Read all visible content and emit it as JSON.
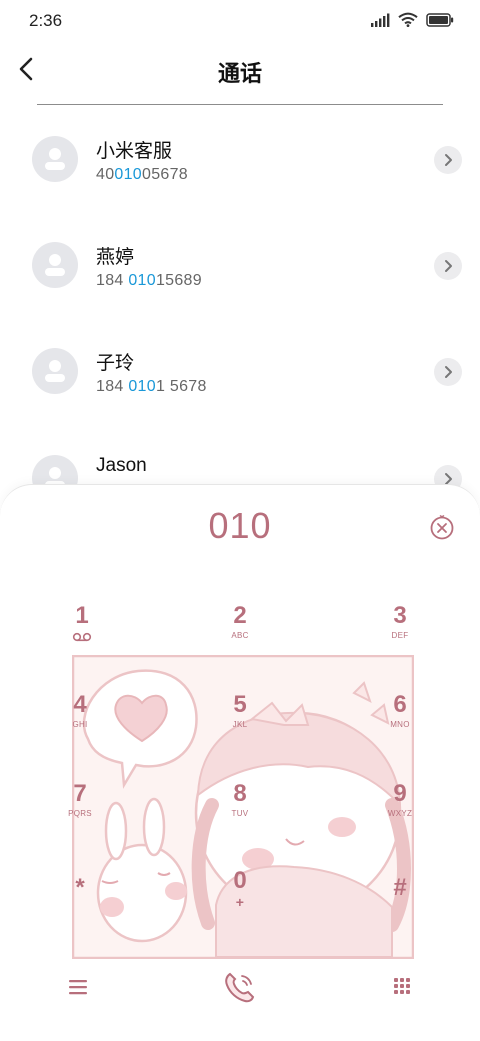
{
  "status": {
    "time": "2:36"
  },
  "header": {
    "title": "通话"
  },
  "contacts": [
    {
      "name": "小米客服",
      "num_pre": "40",
      "num_hl": "010",
      "num_post": "05678"
    },
    {
      "name": "燕婷",
      "num_pre": "184 ",
      "num_hl": "010",
      "num_post": "15689"
    },
    {
      "name": "子玲",
      "num_pre": "184 ",
      "num_hl": "010",
      "num_post": "1 5678"
    },
    {
      "name": "Jason",
      "num_pre": "",
      "num_hl": "",
      "num_post": ""
    }
  ],
  "dialpad": {
    "input": "010",
    "keys": [
      {
        "digit": "1",
        "letters": ""
      },
      {
        "digit": "2",
        "letters": "ABC"
      },
      {
        "digit": "3",
        "letters": "DEF"
      },
      {
        "digit": "4",
        "letters": "GHI"
      },
      {
        "digit": "5",
        "letters": "JKL"
      },
      {
        "digit": "6",
        "letters": "MNO"
      },
      {
        "digit": "7",
        "letters": "PQRS"
      },
      {
        "digit": "8",
        "letters": "TUV"
      },
      {
        "digit": "9",
        "letters": "WXYZ"
      },
      {
        "digit": "*",
        "letters": ""
      },
      {
        "digit": "0",
        "letters": "+"
      },
      {
        "digit": "#",
        "letters": ""
      }
    ]
  },
  "icons": {
    "back": "chevron-left-icon",
    "delete": "delete-icon",
    "voicemail": "voicemail-icon",
    "menu": "menu-icon",
    "call": "phone-icon",
    "keypad": "keypad-icon"
  },
  "colors": {
    "accent": "#b76f7c",
    "highlight": "#1a98d8",
    "avatar_bg": "#e5e6ea"
  }
}
